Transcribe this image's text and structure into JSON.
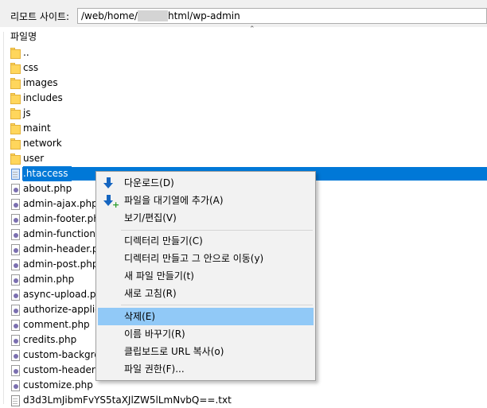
{
  "remote": {
    "label": "리모트 사이트:",
    "path_before": "/web/home/",
    "path_after": "html/wp-admin"
  },
  "column": {
    "filename": "파일명"
  },
  "files": [
    {
      "name": "..",
      "type": "folder"
    },
    {
      "name": "css",
      "type": "folder"
    },
    {
      "name": "images",
      "type": "folder"
    },
    {
      "name": "includes",
      "type": "folder"
    },
    {
      "name": "js",
      "type": "folder"
    },
    {
      "name": "maint",
      "type": "folder"
    },
    {
      "name": "network",
      "type": "folder"
    },
    {
      "name": "user",
      "type": "folder"
    },
    {
      "name": ".htaccess",
      "type": "file",
      "selected": true
    },
    {
      "name": "about.php",
      "type": "php"
    },
    {
      "name": "admin-ajax.php",
      "type": "php"
    },
    {
      "name": "admin-footer.php",
      "type": "php"
    },
    {
      "name": "admin-functions",
      "type": "php"
    },
    {
      "name": "admin-header.ph",
      "type": "php"
    },
    {
      "name": "admin-post.php",
      "type": "php"
    },
    {
      "name": "admin.php",
      "type": "php"
    },
    {
      "name": "async-upload.ph",
      "type": "php"
    },
    {
      "name": "authorize-applica",
      "type": "php"
    },
    {
      "name": "comment.php",
      "type": "php"
    },
    {
      "name": "credits.php",
      "type": "php"
    },
    {
      "name": "custom-backgrou",
      "type": "php"
    },
    {
      "name": "custom-header.p",
      "type": "php"
    },
    {
      "name": "customize.php",
      "type": "php"
    },
    {
      "name": "d3d3LmJibmFvYS5taXJlZW5lLmNvbQ==.txt",
      "type": "file"
    }
  ],
  "context_menu": {
    "download": "다운로드(D)",
    "add_queue": "파일을 대기열에 추가(A)",
    "view_edit": "보기/편집(V)",
    "mkdir": "디렉터리 만들기(C)",
    "mkdir_enter": "디렉터리 만들고 그 안으로 이동(y)",
    "new_file": "새 파일 만들기(t)",
    "refresh": "새로 고침(R)",
    "delete": "삭제(E)",
    "rename": "이름 바꾸기(R)",
    "copy_url": "클립보드로 URL 복사(o)",
    "permissions": "파일 권한(F)..."
  }
}
